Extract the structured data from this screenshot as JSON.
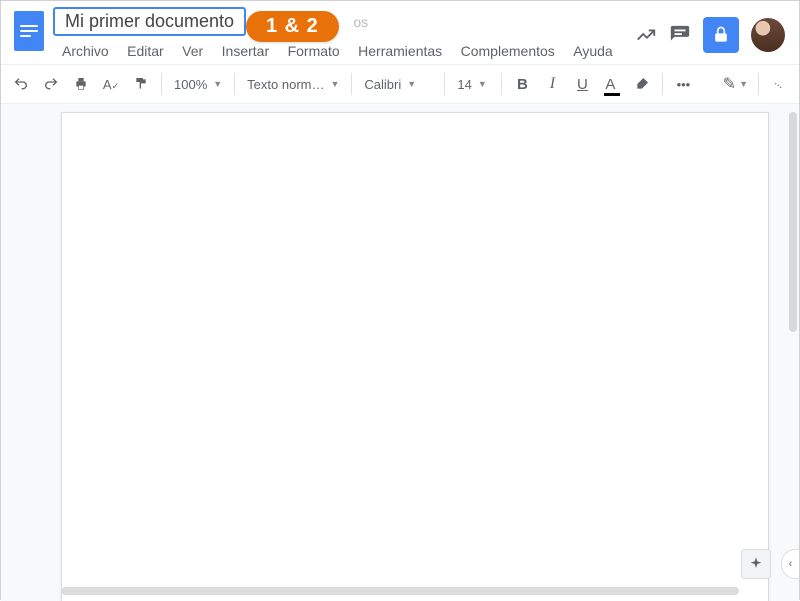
{
  "doc": {
    "title": "Mi primer documento",
    "hidden_text_behind_anno": "os"
  },
  "annotation": {
    "label": "1 & 2"
  },
  "menus": [
    "Archivo",
    "Editar",
    "Ver",
    "Insertar",
    "Formato",
    "Herramientas",
    "Complementos",
    "Ayuda"
  ],
  "toolbar": {
    "zoom": "100%",
    "styles": "Texto norm…",
    "font": "Calibri",
    "font_size": "14",
    "more": "•••"
  }
}
